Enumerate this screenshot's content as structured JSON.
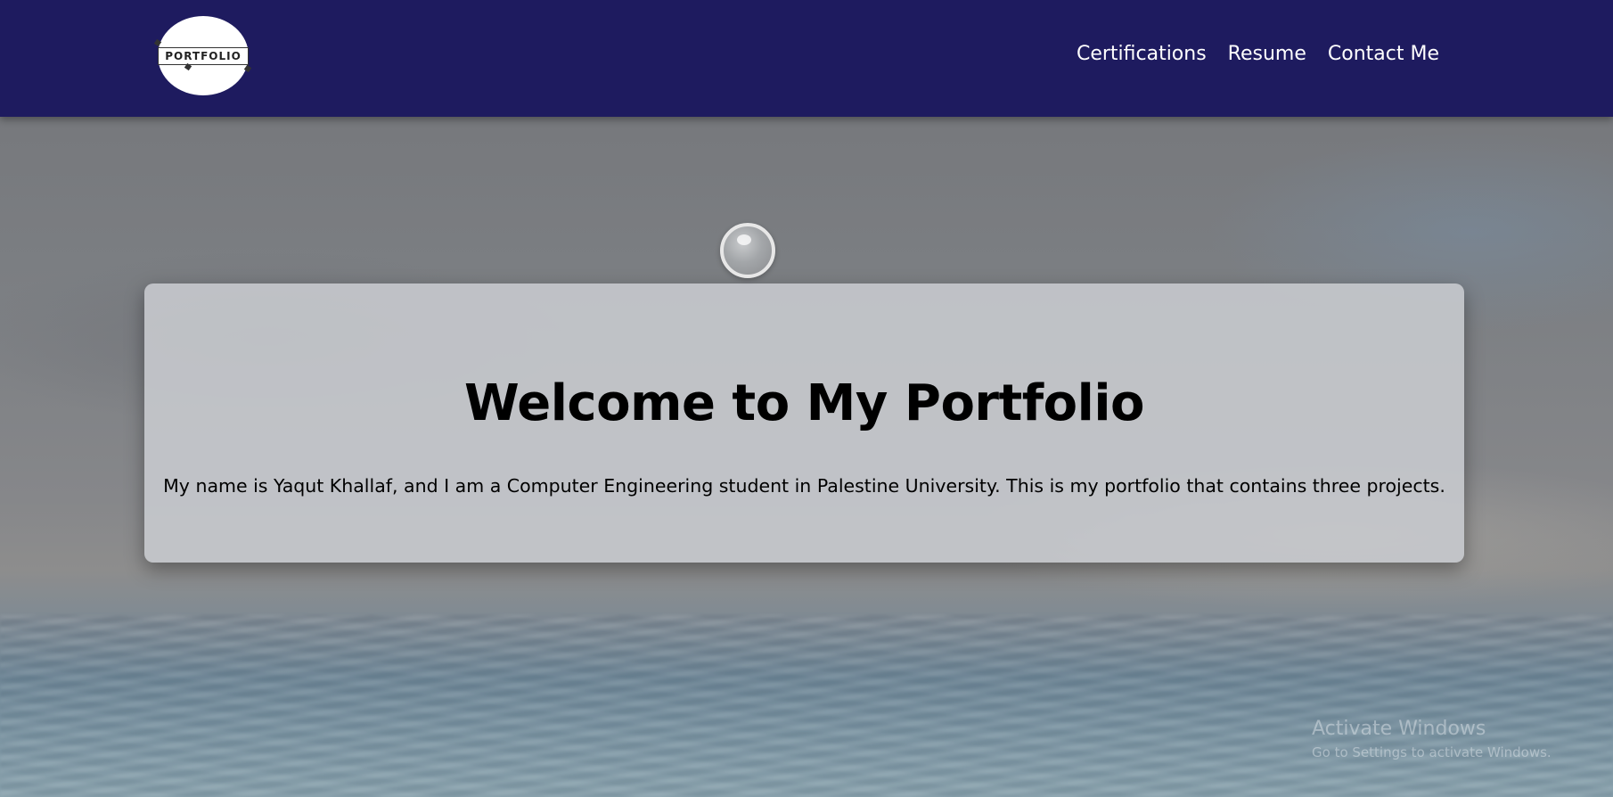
{
  "nav": {
    "logo_text": "PORTFOLIO",
    "links": [
      {
        "label": "Certifications"
      },
      {
        "label": "Resume"
      },
      {
        "label": "Contact Me"
      }
    ]
  },
  "hero": {
    "title": "Welcome to My Portfolio",
    "text": "My name is Yaqut Khallaf, and I am a Computer Engineering student in Palestine University. This is my portfolio that contains three projects."
  },
  "watermark": {
    "title": "Activate Windows",
    "subtitle": "Go to Settings to activate Windows."
  },
  "colors": {
    "navbar": "#1e1b5f",
    "nav_text": "#ffffff",
    "card": "#c8cbcf",
    "title": "#000000"
  }
}
